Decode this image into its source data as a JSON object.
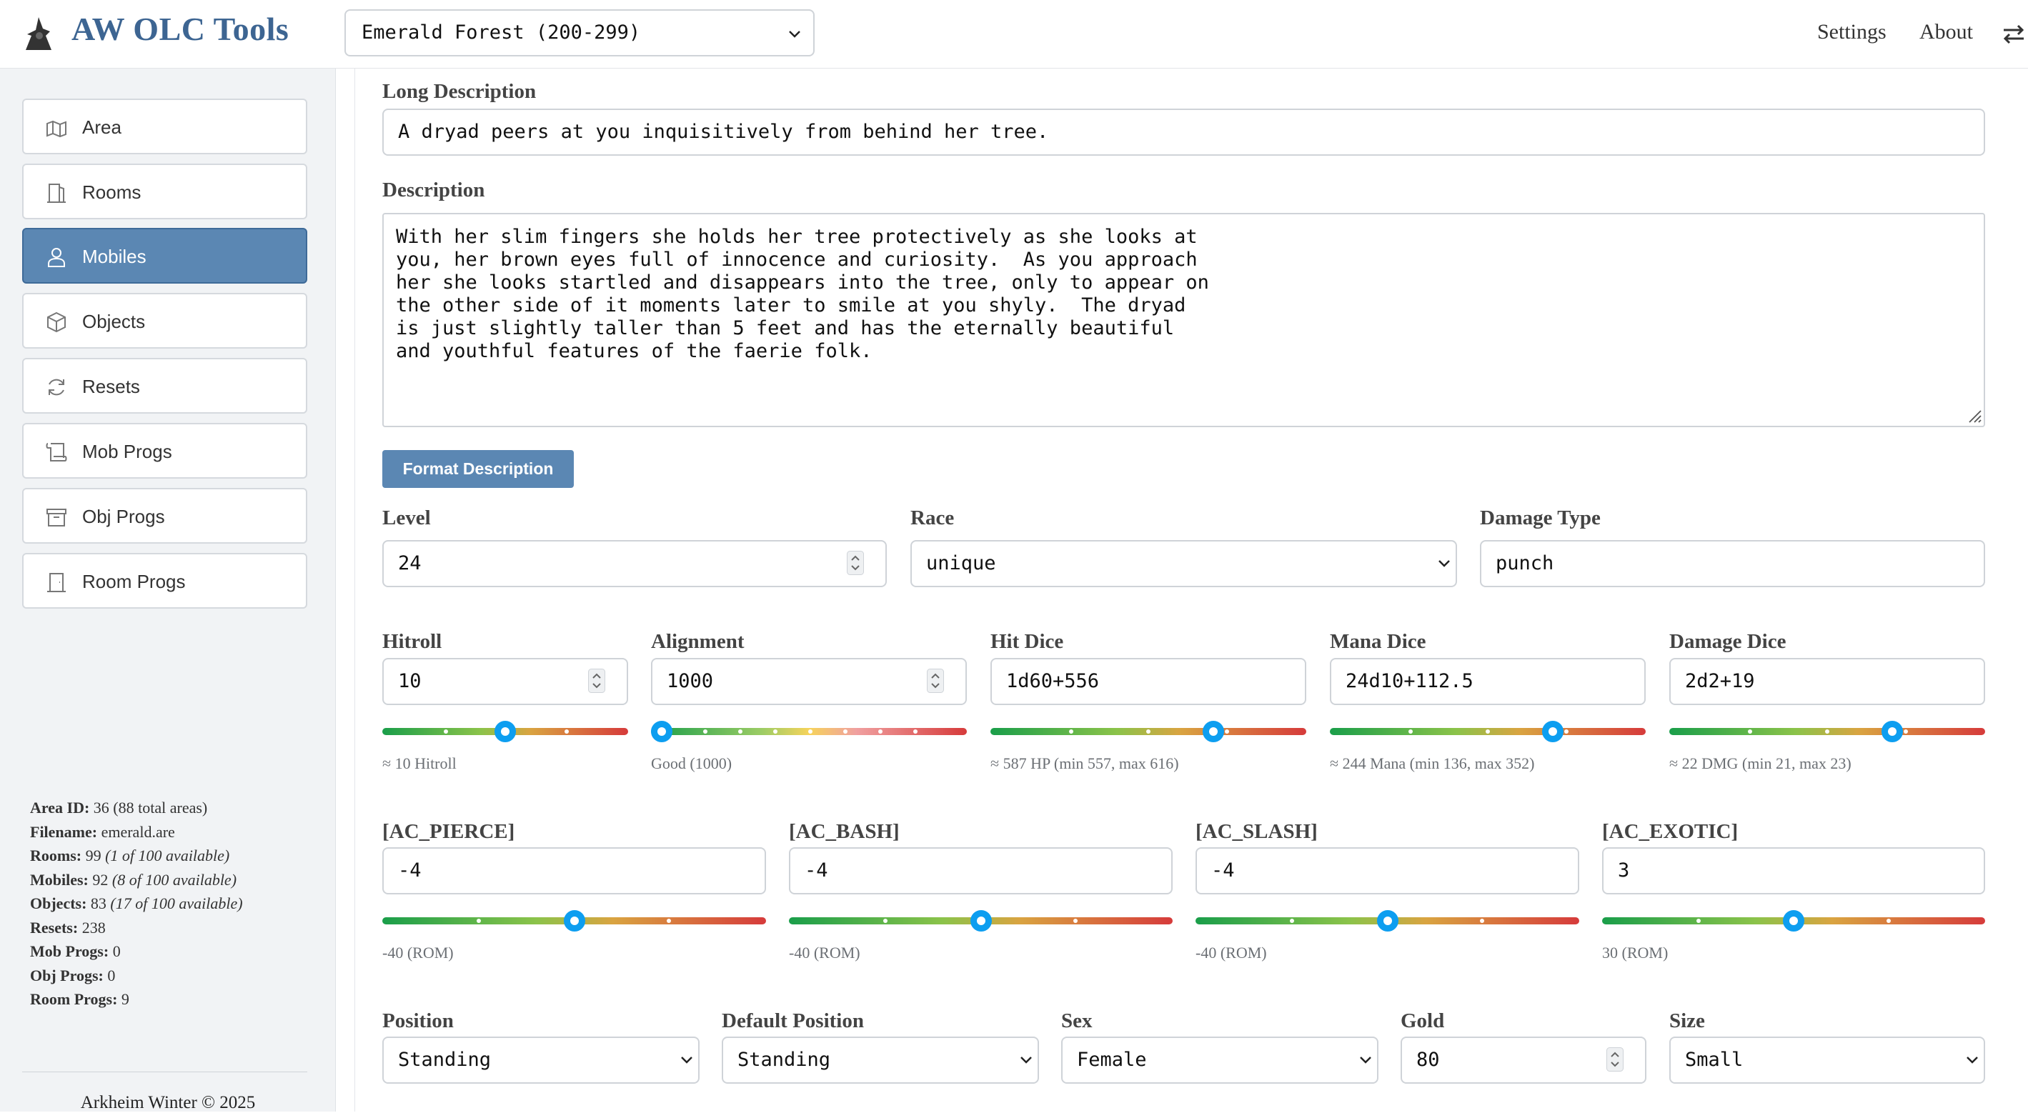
{
  "header": {
    "brand": "AW OLC Tools",
    "area_select": "Emerald Forest (200-299)",
    "nav": {
      "settings": "Settings",
      "about": "About"
    }
  },
  "sidebar": {
    "items": [
      {
        "label": "Area",
        "icon": "map-icon"
      },
      {
        "label": "Rooms",
        "icon": "door-icon"
      },
      {
        "label": "Mobiles",
        "icon": "person-icon",
        "active": true
      },
      {
        "label": "Objects",
        "icon": "cube-icon"
      },
      {
        "label": "Resets",
        "icon": "refresh-icon"
      },
      {
        "label": "Mob Progs",
        "icon": "scroll-icon"
      },
      {
        "label": "Obj Progs",
        "icon": "archive-icon"
      },
      {
        "label": "Room Progs",
        "icon": "door-icon"
      }
    ],
    "stats": {
      "area_id_label": "Area ID:",
      "area_id": "36 (88 total areas)",
      "filename_label": "Filename:",
      "filename": "emerald.are",
      "rooms_label": "Rooms:",
      "rooms": "99",
      "rooms_avail": "(1 of 100 available)",
      "mobiles_label": "Mobiles:",
      "mobiles": "92",
      "mobiles_avail": "(8 of 100 available)",
      "objects_label": "Objects:",
      "objects": "83",
      "objects_avail": "(17 of 100 available)",
      "resets_label": "Resets:",
      "resets": "238",
      "mobprogs_label": "Mob Progs:",
      "mobprogs": "0",
      "objprogs_label": "Obj Progs:",
      "objprogs": "0",
      "roomprogs_label": "Room Progs:",
      "roomprogs": "9"
    },
    "footer": "Arkheim Winter © 2025"
  },
  "form": {
    "long_desc": {
      "label": "Long Description",
      "value": "A dryad peers at you inquisitively from behind her tree."
    },
    "description": {
      "label": "Description",
      "value": "With her slim fingers she holds her tree protectively as she looks at\nyou, her brown eyes full of innocence and curiosity.  As you approach\nher she looks startled and disappears into the tree, only to appear on\nthe other side of it moments later to smile at you shyly.  The dryad\nis just slightly taller than 5 feet and has the eternally beautiful\nand youthful features of the faerie folk."
    },
    "format_button": "Format Description",
    "level": {
      "label": "Level",
      "value": "24"
    },
    "race": {
      "label": "Race",
      "value": "unique"
    },
    "damage_type": {
      "label": "Damage Type",
      "value": "punch"
    },
    "hitroll": {
      "label": "Hitroll",
      "value": "10",
      "hint": "≈ 10 Hitroll",
      "level": 0.5
    },
    "alignment": {
      "label": "Alignment",
      "value": "1000",
      "hint": "Good (1000)",
      "level": 0.0
    },
    "hit_dice": {
      "label": "Hit Dice",
      "value": "1d60+556",
      "hint": "≈ 587 HP (min 557, max 616)",
      "level": 0.72
    },
    "mana_dice": {
      "label": "Mana Dice",
      "value": "24d10+112.5",
      "hint": "≈ 244 Mana (min 136, max 352)",
      "level": 0.72
    },
    "damage_dice": {
      "label": "Damage Dice",
      "value": "2d2+19",
      "hint": "≈ 22 DMG (min 21, max 23)",
      "level": 0.72
    },
    "ac_pierce": {
      "label": "[AC_PIERCE]",
      "value": "-4",
      "hint": "-40 (ROM)",
      "level": 0.5
    },
    "ac_bash": {
      "label": "[AC_BASH]",
      "value": "-4",
      "hint": "-40 (ROM)",
      "level": 0.5
    },
    "ac_slash": {
      "label": "[AC_SLASH]",
      "value": "-4",
      "hint": "-40 (ROM)",
      "level": 0.5
    },
    "ac_exotic": {
      "label": "[AC_EXOTIC]",
      "value": "3",
      "hint": "30 (ROM)",
      "level": 0.5
    },
    "position": {
      "label": "Position",
      "value": "Standing"
    },
    "default_position": {
      "label": "Default Position",
      "value": "Standing"
    },
    "sex": {
      "label": "Sex",
      "value": "Female"
    },
    "gold": {
      "label": "Gold",
      "value": "80"
    },
    "size": {
      "label": "Size",
      "value": "Small"
    }
  },
  "colors": {
    "accent": "#5b87b3",
    "brand": "#3d6592",
    "thumb": "#0d9ef0"
  }
}
